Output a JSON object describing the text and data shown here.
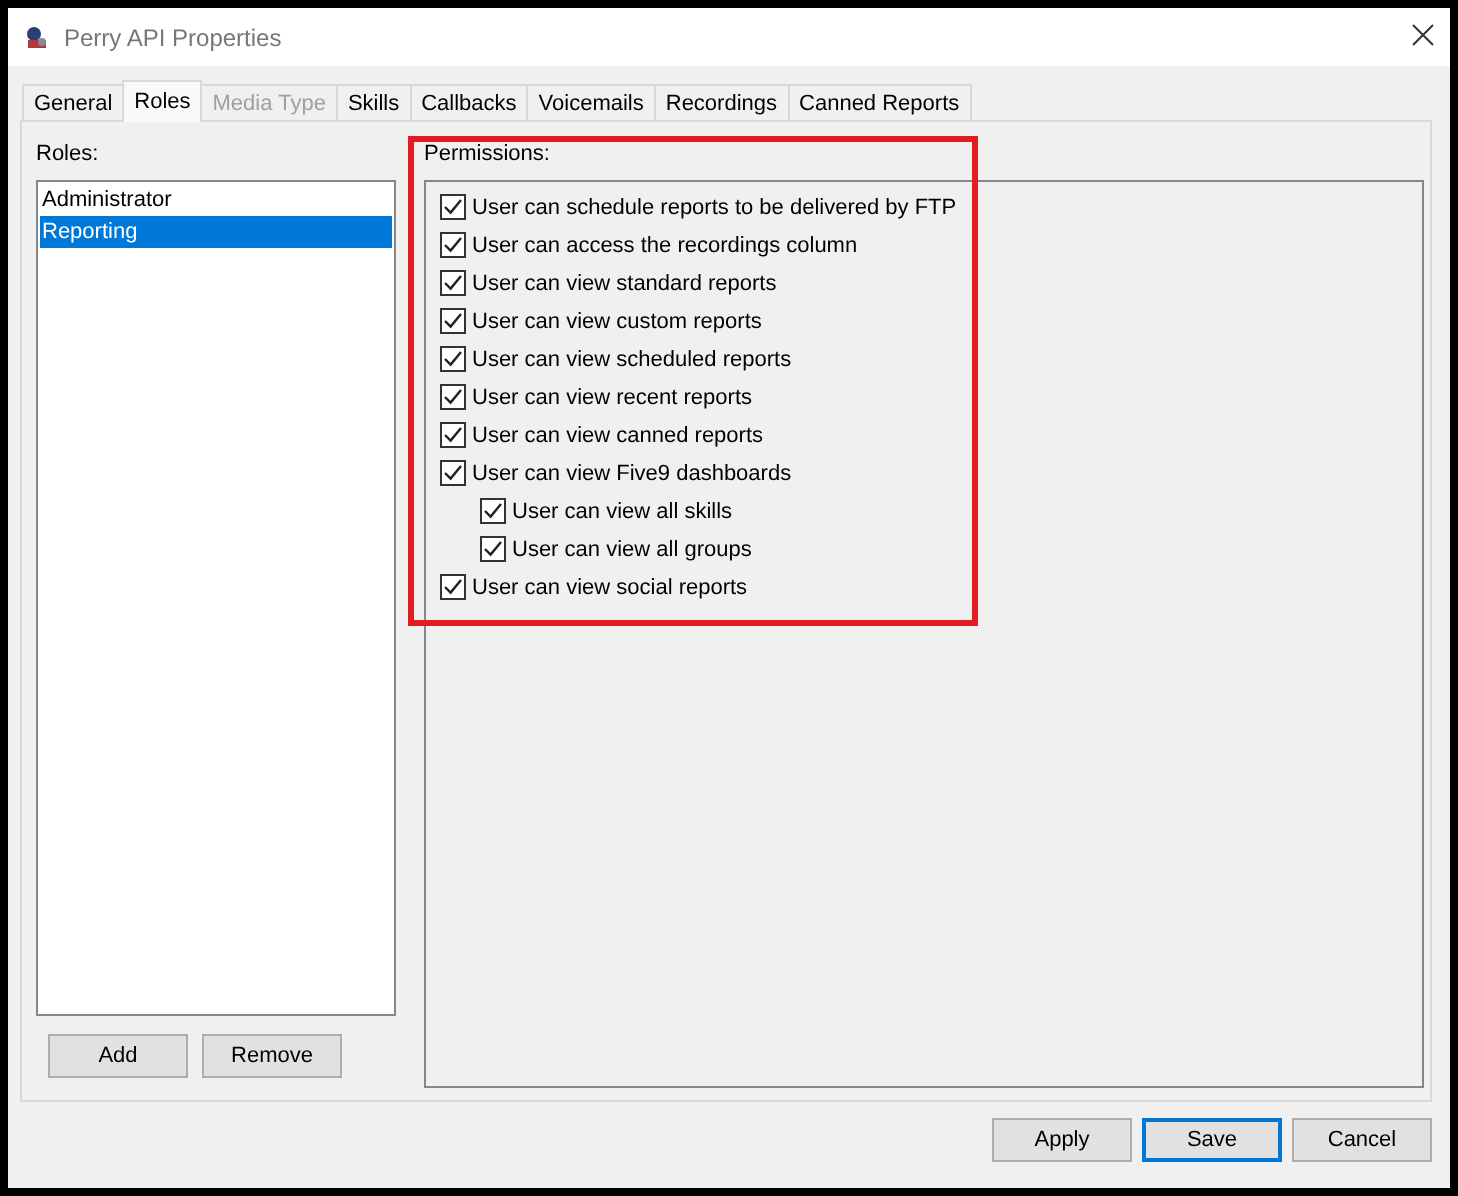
{
  "window": {
    "title": "Perry API Properties"
  },
  "tabs": [
    {
      "label": "General",
      "selected": false,
      "disabled": false
    },
    {
      "label": "Roles",
      "selected": true,
      "disabled": false
    },
    {
      "label": "Media Type",
      "selected": false,
      "disabled": true
    },
    {
      "label": "Skills",
      "selected": false,
      "disabled": false
    },
    {
      "label": "Callbacks",
      "selected": false,
      "disabled": false
    },
    {
      "label": "Voicemails",
      "selected": false,
      "disabled": false
    },
    {
      "label": "Recordings",
      "selected": false,
      "disabled": false
    },
    {
      "label": "Canned Reports",
      "selected": false,
      "disabled": false
    }
  ],
  "roles": {
    "label": "Roles:",
    "items": [
      {
        "label": "Administrator",
        "selected": false
      },
      {
        "label": "Reporting",
        "selected": true
      }
    ],
    "buttons": [
      "Add",
      "Remove"
    ]
  },
  "permissions": {
    "label": "Permissions:",
    "items": [
      {
        "label": "User can schedule reports to be delivered by FTP",
        "checked": true
      },
      {
        "label": "User can access the recordings column",
        "checked": true
      },
      {
        "label": "User can view standard reports",
        "checked": true
      },
      {
        "label": "User can view custom reports",
        "checked": true
      },
      {
        "label": "User can view scheduled reports",
        "checked": true
      },
      {
        "label": "User can view recent reports",
        "checked": true
      },
      {
        "label": "User can view canned reports",
        "checked": true
      },
      {
        "label": "User can view Five9 dashboards",
        "checked": true,
        "children": [
          {
            "label": "User can view all skills",
            "checked": true
          },
          {
            "label": "User can view all groups",
            "checked": true
          }
        ]
      },
      {
        "label": "User can view social reports",
        "checked": true
      }
    ]
  },
  "buttons": [
    {
      "label": "Apply",
      "default": false
    },
    {
      "label": "Save",
      "default": true
    },
    {
      "label": "Cancel",
      "default": false
    }
  ]
}
